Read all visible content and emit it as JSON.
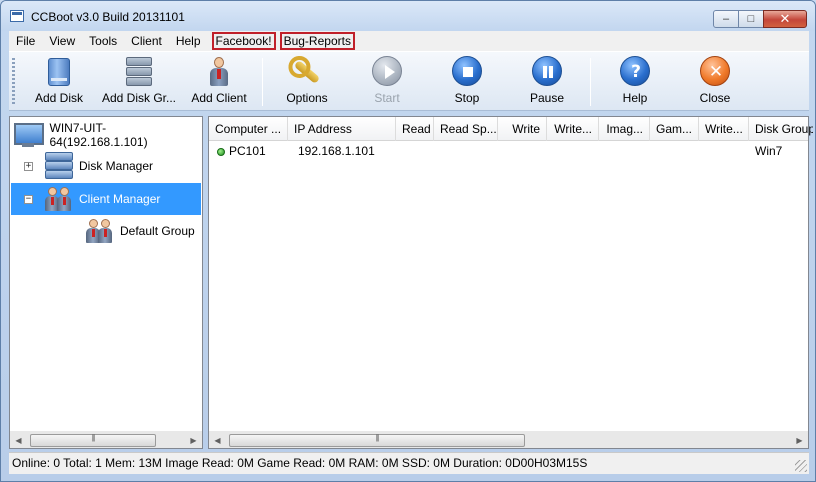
{
  "window": {
    "title": "CCBoot v3.0 Build 20131101",
    "controls": {
      "minimize": "–",
      "maximize": "□",
      "close": "✕"
    }
  },
  "menu": {
    "items": [
      "File",
      "View",
      "Tools",
      "Client",
      "Help"
    ],
    "boxed_items": [
      "Facebook!",
      "Bug-Reports"
    ]
  },
  "toolbar": {
    "add_disk": "Add Disk",
    "add_disk_group": "Add Disk Gr...",
    "add_client": "Add Client",
    "options": "Options",
    "start": "Start",
    "stop": "Stop",
    "pause": "Pause",
    "help": "Help",
    "close": "Close",
    "help_glyph": "?",
    "close_glyph": "✕"
  },
  "tree": {
    "root": "WIN7-UIT-64(192.168.1.101)",
    "disk_manager": "Disk Manager",
    "client_manager": "Client Manager",
    "default_group": "Default Group",
    "expand_glyph": "+",
    "collapse_glyph": "−"
  },
  "list": {
    "columns": [
      "Computer ...",
      "IP Address",
      "Read",
      "Read Sp...",
      "Write",
      "Write...",
      "Imag...",
      "Gam...",
      "Write...",
      "Disk Group"
    ],
    "rows": [
      {
        "computer": "PC101",
        "ip": "192.168.1.101",
        "disk_group": "Win7",
        "status_color": "#1f8d1f"
      }
    ]
  },
  "scroll": {
    "left": "◀",
    "right": "▶",
    "thumb": "III"
  },
  "status": {
    "text": "Online: 0 Total: 1 Mem: 13M Image Read: 0M Game Read: 0M RAM: 0M SSD: 0M Duration: 0D00H03M15S"
  }
}
